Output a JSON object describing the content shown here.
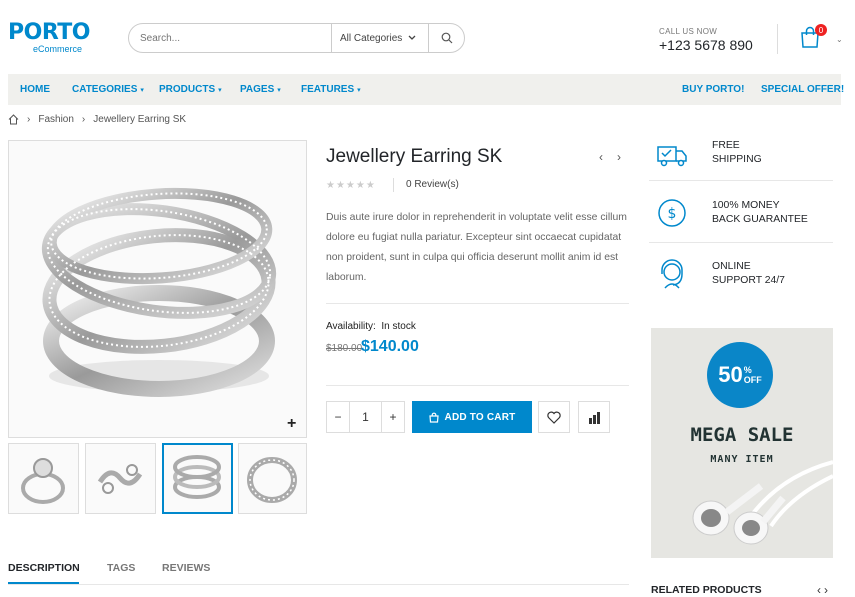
{
  "header": {
    "logo_main": "PORTO",
    "logo_sub": "eCommerce",
    "search_placeholder": "Search...",
    "search_category": "All Categories",
    "call_label": "CALL US NOW",
    "phone": "+123 5678 890",
    "cart_count": "0"
  },
  "nav": {
    "items": [
      "HOME",
      "CATEGORIES",
      "PRODUCTS",
      "PAGES",
      "FEATURES"
    ],
    "right_items": [
      "BUY PORTO!",
      "SPECIAL OFFER!"
    ]
  },
  "breadcrumb": [
    "Fashion",
    "Jewellery Earring SK"
  ],
  "product": {
    "title": "Jewellery Earring SK",
    "rating": "★★★★★",
    "reviews": "0 Review(s)",
    "description": "Duis aute irure dolor in reprehenderit in voluptate velit esse cillum dolore eu fugiat nulla pariatur. Excepteur sint occaecat cupidatat non proident, sunt in culpa qui officia deserunt mollit anim id est laborum.",
    "availability_label": "Availability:",
    "availability_value": "In stock",
    "old_price": "$180.00",
    "new_price": "$140.00",
    "quantity": "1",
    "add_to_cart": "ADD TO CART",
    "zoom": "+"
  },
  "tabs": [
    "DESCRIPTION",
    "TAGS",
    "REVIEWS"
  ],
  "sidebar": {
    "features": [
      {
        "line1": "FREE",
        "line2": "SHIPPING",
        "icon": "truck-icon"
      },
      {
        "line1": "100% MONEY",
        "line2": "BACK GUARANTEE",
        "icon": "dollar-icon"
      },
      {
        "line1": "ONLINE",
        "line2": "SUPPORT 24/7",
        "icon": "support-icon"
      }
    ],
    "banner": {
      "badge_num": "50",
      "badge_pct": "%",
      "badge_off": "OFF",
      "title": "MEGA SALE",
      "subtitle": "MANY ITEM"
    },
    "related_title": "RELATED PRODUCTS"
  },
  "colors": {
    "accent": "#0088cc",
    "text": "#222529",
    "nav_bg": "#f0f0ed"
  }
}
